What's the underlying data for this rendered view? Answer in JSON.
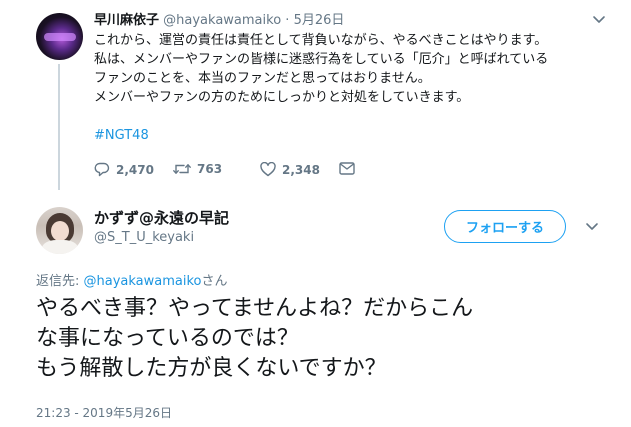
{
  "parent_tweet": {
    "display_name": "早川麻依子",
    "handle": "@hayakawamaiko",
    "separator": "·",
    "date": "5月26日",
    "body_lines": [
      "これから、運営の責任は責任として背負いながら、やるべきことはやります。",
      "私は、メンバーやファンの皆様に迷惑行為をしている「厄介」と呼ばれている",
      "ファンのことを、本当のファンだと思ってはおりません。",
      "メンバーやファンの方のためにしっかりと対処をしていきます。"
    ],
    "hashtag": "#NGT48",
    "actions": {
      "replies": "2,470",
      "retweets": "763",
      "likes": "2,348"
    }
  },
  "reply_tweet": {
    "display_name": "かずず@永遠の早記",
    "handle": "@S_T_U_keyaki",
    "follow_label": "フォローする",
    "replying_prefix": "返信先: ",
    "replying_mention": "@hayakawamaiko",
    "replying_suffix": "さん",
    "body_lines": [
      "やるべき事？やってませんよね？だからこん",
      "な事になっているのでは？",
      "もう解散した方が良くないですか？"
    ],
    "timestamp": "21:23 - 2019年5月26日"
  },
  "icons": {
    "reply": "reply-icon",
    "retweet": "retweet-icon",
    "like": "heart-icon",
    "dm": "envelope-icon",
    "more": "chevron-down-icon"
  },
  "colors": {
    "accent": "#1da1f2",
    "link": "#1b95e0",
    "muted": "#657786",
    "text": "#14171a"
  }
}
